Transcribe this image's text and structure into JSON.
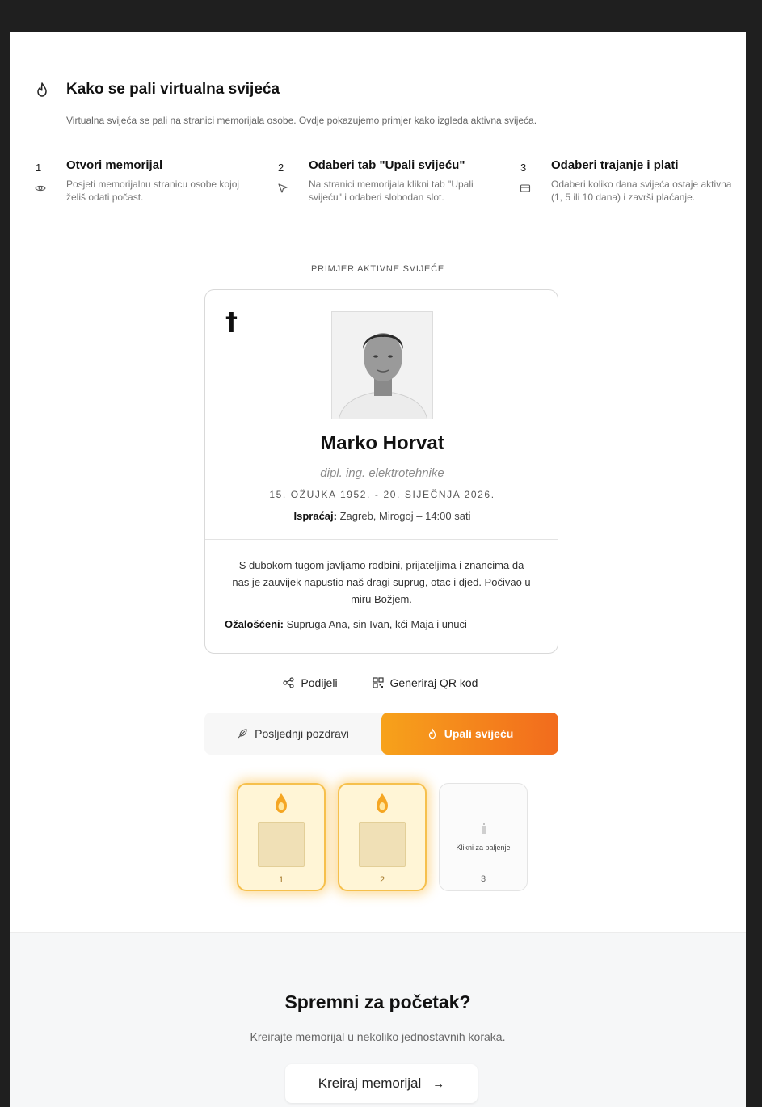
{
  "section": {
    "title": "Kako se pali virtualna svijeća",
    "subtitle": "Virtualna svijeća se pali na stranici memorijala osobe. Ovdje pokazujemo primjer kako izgleda aktivna svijeća.",
    "icon": "flame-icon"
  },
  "steps": [
    {
      "number": "1",
      "title": "Otvori memorijal",
      "description": "Posjeti memorijalnu stranicu osobe kojoj želiš odati počast.",
      "icon": "eye-icon"
    },
    {
      "number": "2",
      "title": "Odaberi tab \"Upali svijeću\"",
      "description": "Na stranici memorijala klikni tab \"Upali svijeću\" i odaberi slobodan slot.",
      "icon": "cursor-icon"
    },
    {
      "number": "3",
      "title": "Odaberi trajanje i plati",
      "description": "Odaberi koliko dana svijeća ostaje aktivna (1, 5 ili 10 dana) i završi plaćanje.",
      "icon": "card-icon"
    }
  ],
  "example_label": "PRIMJER AKTIVNE SVIJEĆE",
  "memorial": {
    "cross": "†",
    "name": "Marko Horvat",
    "title": "dipl. ing. elektrotehnike",
    "dates": "15. OŽUJKA 1952. - 20. SIJEČNJA 2026.",
    "funeral_label": "Ispraćaj:",
    "funeral_value": "Zagreb, Mirogoj – 14:00 sati",
    "message": "S dubokom tugom javljamo rodbini, prijateljima i znancima da nas je zauvijek napustio naš dragi suprug, otac i djed. Počivao u miru Božjem.",
    "mourners_label": "Ožalošćeni:",
    "mourners_value": "Supruga Ana, sin Ivan, kći Maja i unuci"
  },
  "actions": {
    "share": "Podijeli",
    "qr": "Generiraj QR kod"
  },
  "tabs": {
    "left": "Posljednji pozdravi",
    "right": "Upali svijeću"
  },
  "candles": [
    {
      "number": "1",
      "lit": true
    },
    {
      "number": "2",
      "lit": true
    },
    {
      "number": "3",
      "lit": false,
      "hint": "Klikni za paljenje"
    }
  ],
  "footer": {
    "title": "Spremni za početak?",
    "subtitle": "Kreirajte memorijal u nekoliko jednostavnih koraka.",
    "button": "Kreiraj memorijal",
    "arrow": "→"
  },
  "colors": {
    "accent_start": "#f7a21b",
    "accent_end": "#f26b1d",
    "candle_glow": "#f6c04d"
  }
}
